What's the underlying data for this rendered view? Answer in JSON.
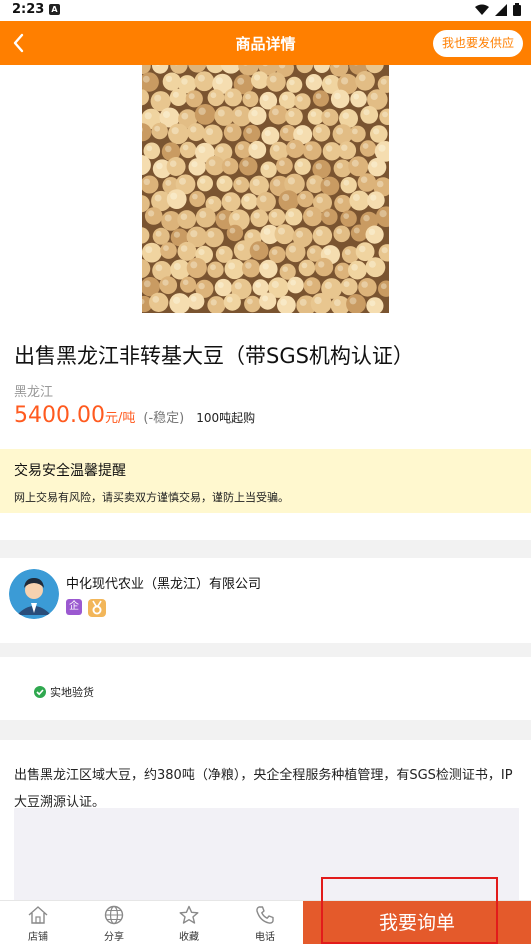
{
  "status_bar": {
    "time": "2:23",
    "notification_icon": "A"
  },
  "header": {
    "title": "商品详情",
    "supply_button": "我也要发供应"
  },
  "product": {
    "title": "出售黑龙江非转基大豆（带SGS机构认证）",
    "origin": "黑龙江",
    "price": "5400.00",
    "unit": "元/吨",
    "stability": "(-稳定)",
    "min_order": "100吨起购"
  },
  "notice": {
    "title": "交易安全温馨提醒",
    "text": "网上交易有风险，请买卖双方谨慎交易，谨防上当受骗。"
  },
  "company": {
    "name": "中化现代农业（黑龙江）有限公司",
    "enterprise_badge": "企"
  },
  "verification": {
    "label": "实地验货"
  },
  "description": {
    "text": "出售黑龙江区域大豆，约380吨（净粮），央企全程服务种植管理，有SGS检测证书，IP大豆溯源认证。"
  },
  "bottom_bar": {
    "tabs": [
      {
        "label": "店铺",
        "icon": "home-icon"
      },
      {
        "label": "分享",
        "icon": "globe-icon"
      },
      {
        "label": "收藏",
        "icon": "star-icon"
      },
      {
        "label": "电话",
        "icon": "phone-icon"
      }
    ],
    "inquiry_button": "我要询单"
  },
  "colors": {
    "brand": "#ff7f00",
    "price": "#ff5a1f",
    "inquiry": "#e45a2b",
    "notice_bg": "#fff8cf"
  }
}
